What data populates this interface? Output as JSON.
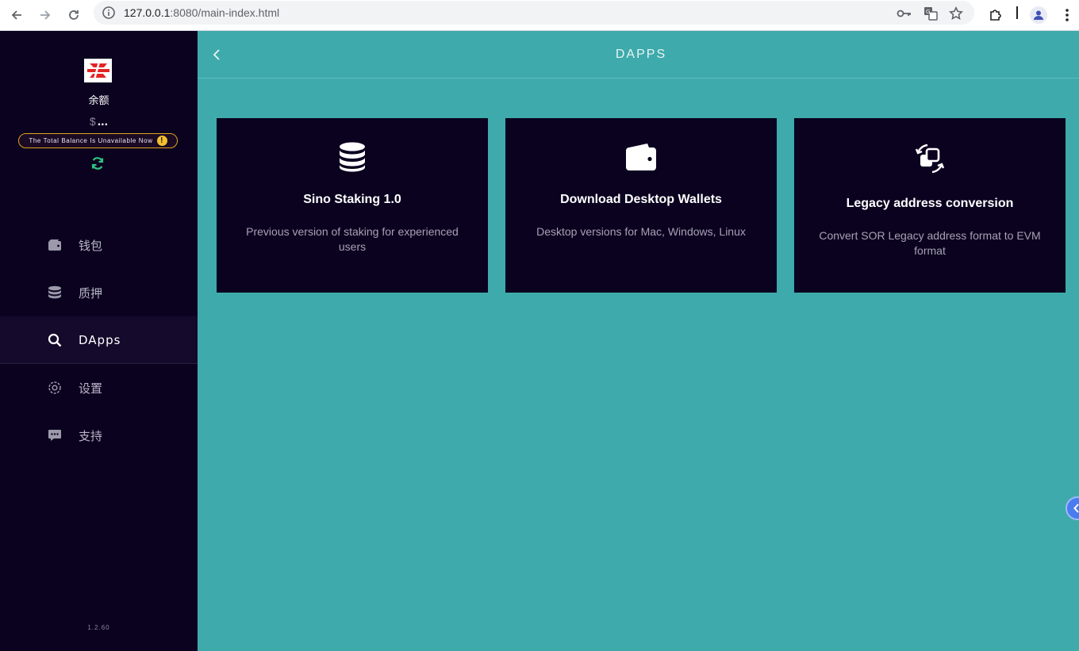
{
  "browser": {
    "url_host": "127.0.0.1",
    "url_rest": ":8080/main-index.html"
  },
  "sidebar": {
    "balance_label": "余额",
    "balance_currency": "$",
    "balance_value": "...",
    "warning_text": "The Total Balance Is Unavailable Now",
    "warning_mark": "!",
    "menu": [
      {
        "label": "钱包",
        "icon": "wallet-icon"
      },
      {
        "label": "质押",
        "icon": "database-icon"
      },
      {
        "label": "DApps",
        "icon": "search-icon"
      },
      {
        "label": "设置",
        "icon": "gear-icon"
      },
      {
        "label": "支持",
        "icon": "chat-icon"
      }
    ],
    "active_index": 2,
    "version": "1.2.60"
  },
  "main": {
    "title": "DAPPS",
    "cards": [
      {
        "title": "Sino Staking 1.0",
        "description": "Previous version of staking for experienced users",
        "icon": "database-icon"
      },
      {
        "title": "Download Desktop Wallets",
        "description": "Desktop versions for Mac, Windows, Linux",
        "icon": "wallet-icon"
      },
      {
        "title": "Legacy address conversion",
        "description": "Convert SOR Legacy address format to EVM format",
        "icon": "convert-icon"
      }
    ]
  },
  "colors": {
    "sidebar_bg": "#0b0220",
    "main_bg": "#3eaaab",
    "card_bg": "#0b0220",
    "warning_border": "#e0a31a",
    "refresh_green": "#2ec27e"
  }
}
